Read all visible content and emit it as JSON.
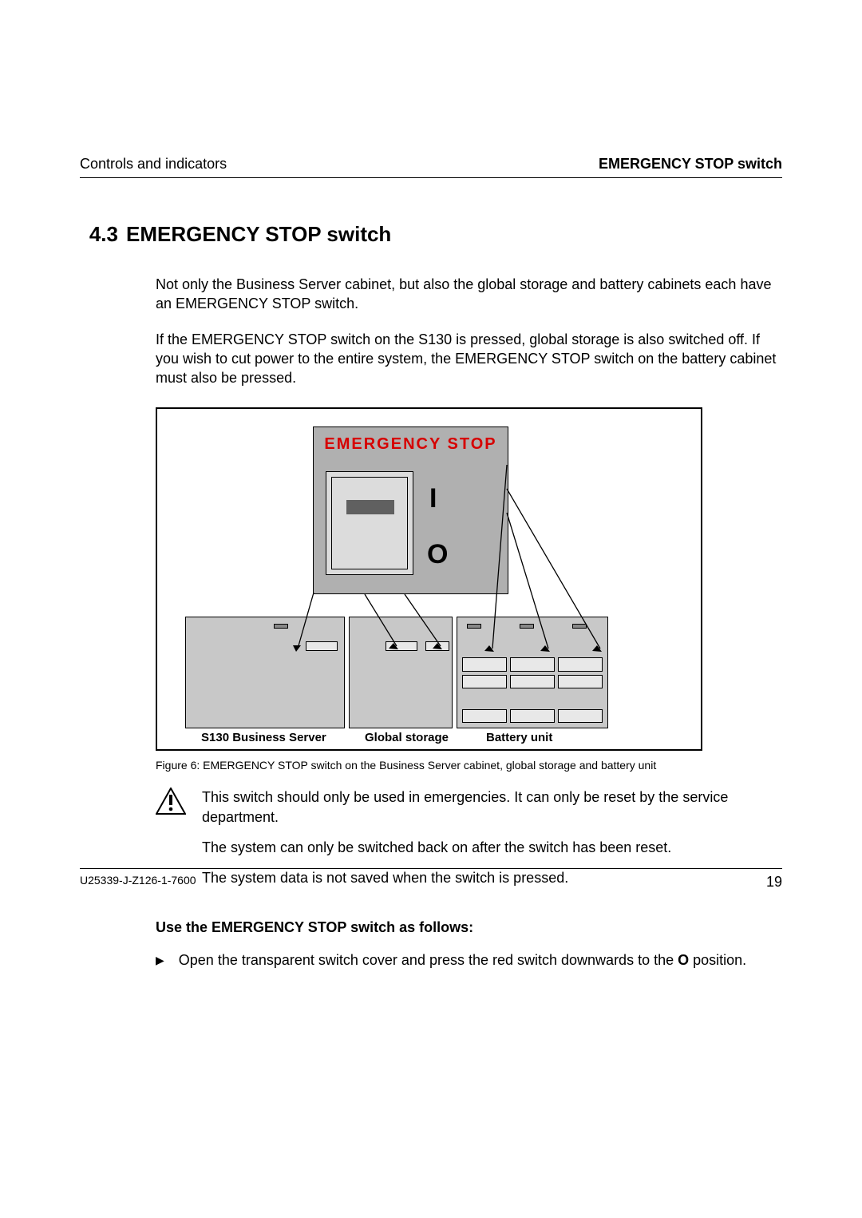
{
  "header": {
    "left": "Controls and indicators",
    "right": "EMERGENCY STOP switch"
  },
  "section": {
    "number": "4.3",
    "title": "EMERGENCY STOP switch"
  },
  "paragraphs": {
    "p1": "Not only the Business Server cabinet, but also the global storage and battery cabinets each have an EMERGENCY STOP switch.",
    "p2": "If the EMERGENCY STOP switch on the S130 is pressed, global storage is also switched off. If you wish to cut power to the entire system, the EMERGENCY STOP switch on the battery cabinet must also be pressed."
  },
  "figure": {
    "panel_title": "EMERGENCY  STOP",
    "mark_on": "I",
    "mark_off": "O",
    "labels": {
      "server": "S130 Business Server",
      "storage": "Global storage",
      "battery": "Battery unit"
    },
    "caption": "Figure 6: EMERGENCY STOP switch on the Business Server cabinet, global storage and battery unit"
  },
  "warning": {
    "w1": "This switch should only be used in emergencies. It can only be reset by the service department.",
    "w2": "The system can only be switched back on after the switch has been reset.",
    "w3": "The system data is not saved when the switch is pressed."
  },
  "instructions": {
    "heading": "Use the EMERGENCY STOP switch as follows:",
    "step1_pre": "Open the transparent switch cover and press the red switch downwards to the ",
    "step1_bold": "O",
    "step1_post": " position."
  },
  "footer": {
    "docid": "U25339-J-Z126-1-7600",
    "page": "19"
  }
}
